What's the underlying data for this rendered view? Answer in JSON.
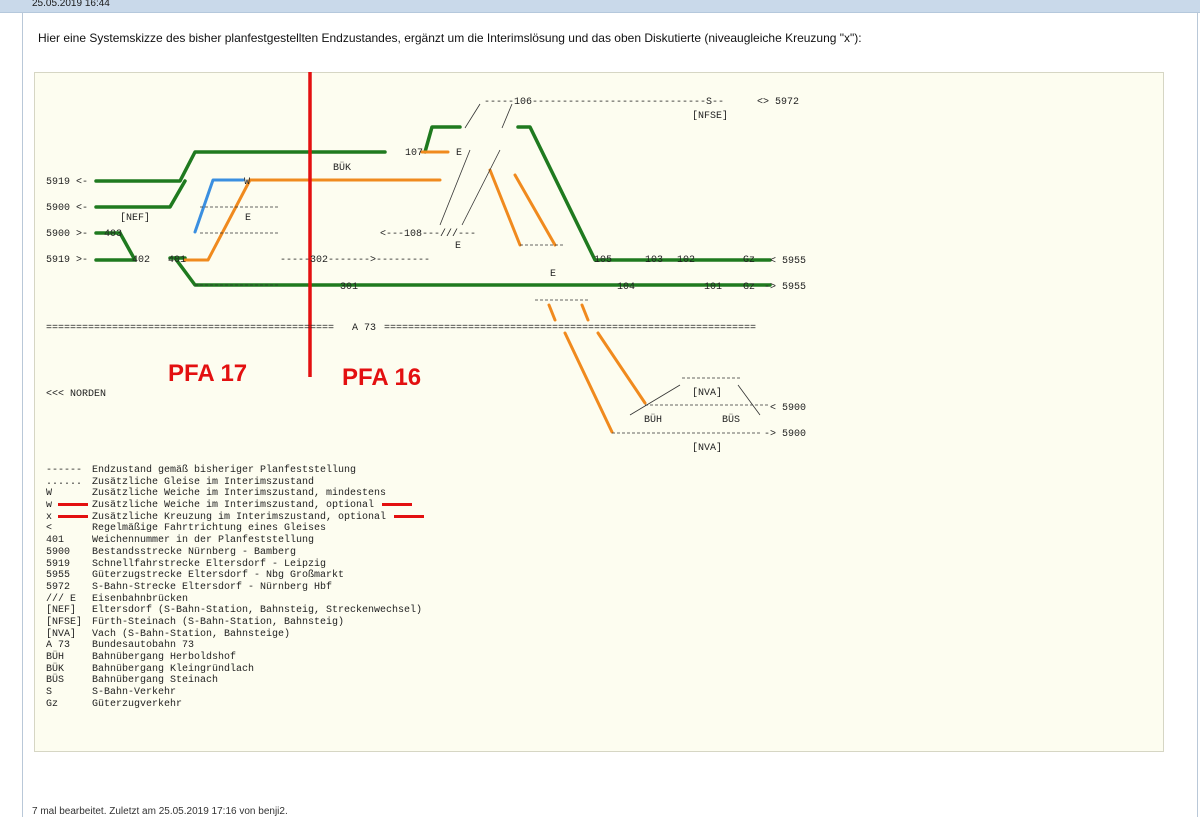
{
  "post": {
    "date": "25.05.2019 16:44",
    "intro": "Hier eine Systemskizze des bisher planfestgestellten Endzustandes, ergänzt um die Interimslösung und das oben Diskutierte (niveaugleiche Kreuzung \"x\"):",
    "edit_note": "7 mal bearbeitet. Zuletzt am 25.05.2019 17:16 von benji2."
  },
  "colors": {
    "final_state": "#1f7a1f",
    "interim_track": "#f08a1e",
    "optional_switch": "#3b8fe0",
    "boundary": "#e31010"
  },
  "diagram": {
    "pfa_left": "PFA 17",
    "pfa_right": "PFA 16",
    "north": "<<< NORDEN",
    "highway": "A 73",
    "left_labels": [
      "5919 <-",
      "5900 <-",
      "5900 >-",
      "5919 >-"
    ],
    "right_labels": [
      "<> 5972",
      "< 5955",
      "-> 5955",
      "< 5900",
      "-> 5900"
    ],
    "stations": {
      "nef": "[NEF]",
      "nfse": "[NFSE]",
      "nva_top": "[NVA]",
      "nva_bottom": "[NVA]",
      "buek": "BÜK",
      "bueh": "BÜH",
      "bues": "BÜS"
    },
    "track_texts": {
      "s106": "-----106-----------------------------S--",
      "n108": "<---108---///---",
      "n302": "-----302------->---------",
      "n301": "301",
      "n403": "403",
      "n402": "402",
      "n401": "401",
      "n107": "107",
      "w": "W",
      "e": "E",
      "n105": "105",
      "n104": "104",
      "n103": "103",
      "n102": "102",
      "n101": "101",
      "gz": "Gz",
      "a73_left": "================================================",
      "a73_right": "=============================================================="
    }
  },
  "legend": [
    {
      "sym": "------",
      "desc": "Endzustand gemäß bisheriger Planfeststellung",
      "red": false
    },
    {
      "sym": "......",
      "desc": "Zusätzliche Gleise im Interimszustand",
      "red": false
    },
    {
      "sym": "W",
      "desc": "Zusätzliche Weiche im Interimszustand, mindestens",
      "red": false
    },
    {
      "sym": "w",
      "desc": "Zusätzliche Weiche im Interimszustand, optional",
      "red": true
    },
    {
      "sym": "x",
      "desc": "Zusätzliche Kreuzung im Interimszustand, optional",
      "red": true
    },
    {
      "sym": "<",
      "desc": "Regelmäßige Fahrtrichtung eines Gleises",
      "red": false
    },
    {
      "sym": "401",
      "desc": "Weichennummer in der Planfeststellung",
      "red": false
    },
    {
      "sym": "5900",
      "desc": "Bestandsstrecke Nürnberg - Bamberg",
      "red": false
    },
    {
      "sym": "5919",
      "desc": "Schnellfahrstrecke Eltersdorf - Leipzig",
      "red": false
    },
    {
      "sym": "5955",
      "desc": "Güterzugstrecke Eltersdorf - Nbg Großmarkt",
      "red": false
    },
    {
      "sym": "5972",
      "desc": "S-Bahn-Strecke Eltersdorf - Nürnberg Hbf",
      "red": false
    },
    {
      "sym": "/// E",
      "desc": "Eisenbahnbrücken",
      "red": false
    },
    {
      "sym": "[NEF]",
      "desc": "Eltersdorf (S-Bahn-Station, Bahnsteig, Streckenwechsel)",
      "red": false
    },
    {
      "sym": "[NFSE]",
      "desc": "Fürth-Steinach (S-Bahn-Station, Bahnsteig)",
      "red": false
    },
    {
      "sym": "[NVA]",
      "desc": "Vach (S-Bahn-Station, Bahnsteige)",
      "red": false
    },
    {
      "sym": "A 73",
      "desc": "Bundesautobahn 73",
      "red": false
    },
    {
      "sym": "BÜH",
      "desc": "Bahnübergang Herboldshof",
      "red": false
    },
    {
      "sym": "BÜK",
      "desc": "Bahnübergang Kleingründlach",
      "red": false
    },
    {
      "sym": "BÜS",
      "desc": "Bahnübergang Steinach",
      "red": false
    },
    {
      "sym": "S",
      "desc": "S-Bahn-Verkehr",
      "red": false
    },
    {
      "sym": "Gz",
      "desc": "Güterzugverkehr",
      "red": false
    }
  ]
}
